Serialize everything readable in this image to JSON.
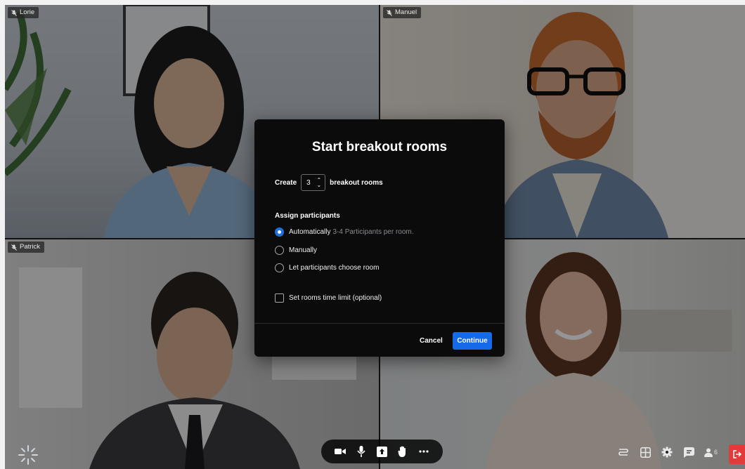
{
  "participants": [
    {
      "name": "Lorie"
    },
    {
      "name": "Manuel"
    },
    {
      "name": "Patrick"
    }
  ],
  "dialog": {
    "title": "Start breakout rooms",
    "create_label": "Create",
    "room_count": "3",
    "rooms_suffix": "breakout rooms",
    "assign_title": "Assign participants",
    "options": [
      {
        "label": "Automatically",
        "hint": "3-4 Participants per room.",
        "selected": true
      },
      {
        "label": "Manually",
        "hint": "",
        "selected": false
      },
      {
        "label": "Let participants choose room",
        "hint": "",
        "selected": false
      }
    ],
    "time_limit_label": "Set rooms time limit (optional)",
    "cancel_label": "Cancel",
    "continue_label": "Continue",
    "accent_color": "#1669e8"
  },
  "toolbar": {
    "controls": [
      "camera-icon",
      "microphone-icon",
      "share-screen-icon",
      "raise-hand-icon",
      "more-icon"
    ],
    "right_tools": [
      "breakout-rooms-icon",
      "grid-view-icon",
      "settings-icon",
      "chat-icon",
      "participants-icon"
    ],
    "participant_count": "6",
    "leave_color": "#e23b3b"
  }
}
